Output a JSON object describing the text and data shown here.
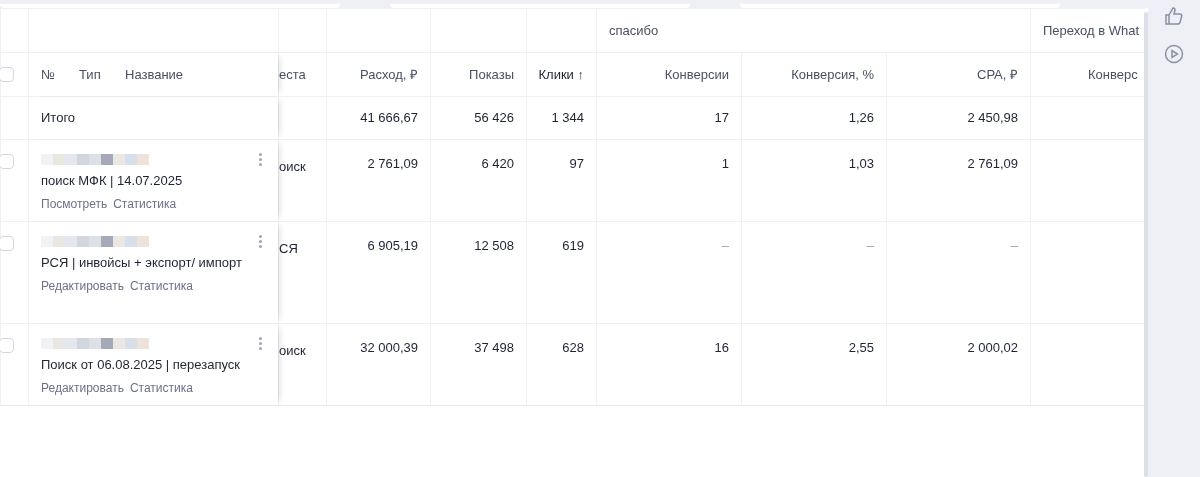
{
  "group_headers": [
    {
      "label": "спасибо"
    },
    {
      "label": "Переход в What"
    }
  ],
  "header": {
    "checked": false,
    "number": "№",
    "type": "Тип",
    "name": "Название",
    "places": "еста",
    "columns": [
      "Расход, ₽",
      "Показы",
      "Клики ↑",
      "Конверсии",
      "Конверсия, %",
      "CPA, ₽",
      "Конверс"
    ]
  },
  "total": {
    "label": "Итого",
    "values": [
      "41 666,67",
      "56 426",
      "1 344",
      "17",
      "1,26",
      "2 450,98"
    ]
  },
  "rows": [
    {
      "checked": false,
      "name": "поиск МФК | 14.07.2025",
      "links": [
        "Посмотреть",
        "Статистика"
      ],
      "places": "оиск",
      "values": [
        "2 761,09",
        "6 420",
        "97",
        "1",
        "1,03",
        "2 761,09"
      ]
    },
    {
      "checked": false,
      "name": "РСЯ | инвойсы + экспорт/ импорт",
      "links": [
        "Редактировать",
        "Статистика"
      ],
      "places": "СЯ",
      "values": [
        "6 905,19",
        "12 508",
        "619",
        "–",
        "–",
        "–"
      ]
    },
    {
      "checked": false,
      "name": "Поиск от 06.08.2025 | перезапуск",
      "links": [
        "Редактировать",
        "Статистика"
      ],
      "places": "оиск",
      "values": [
        "32 000,39",
        "37 498",
        "628",
        "16",
        "2,55",
        "2 000,02"
      ]
    }
  ]
}
